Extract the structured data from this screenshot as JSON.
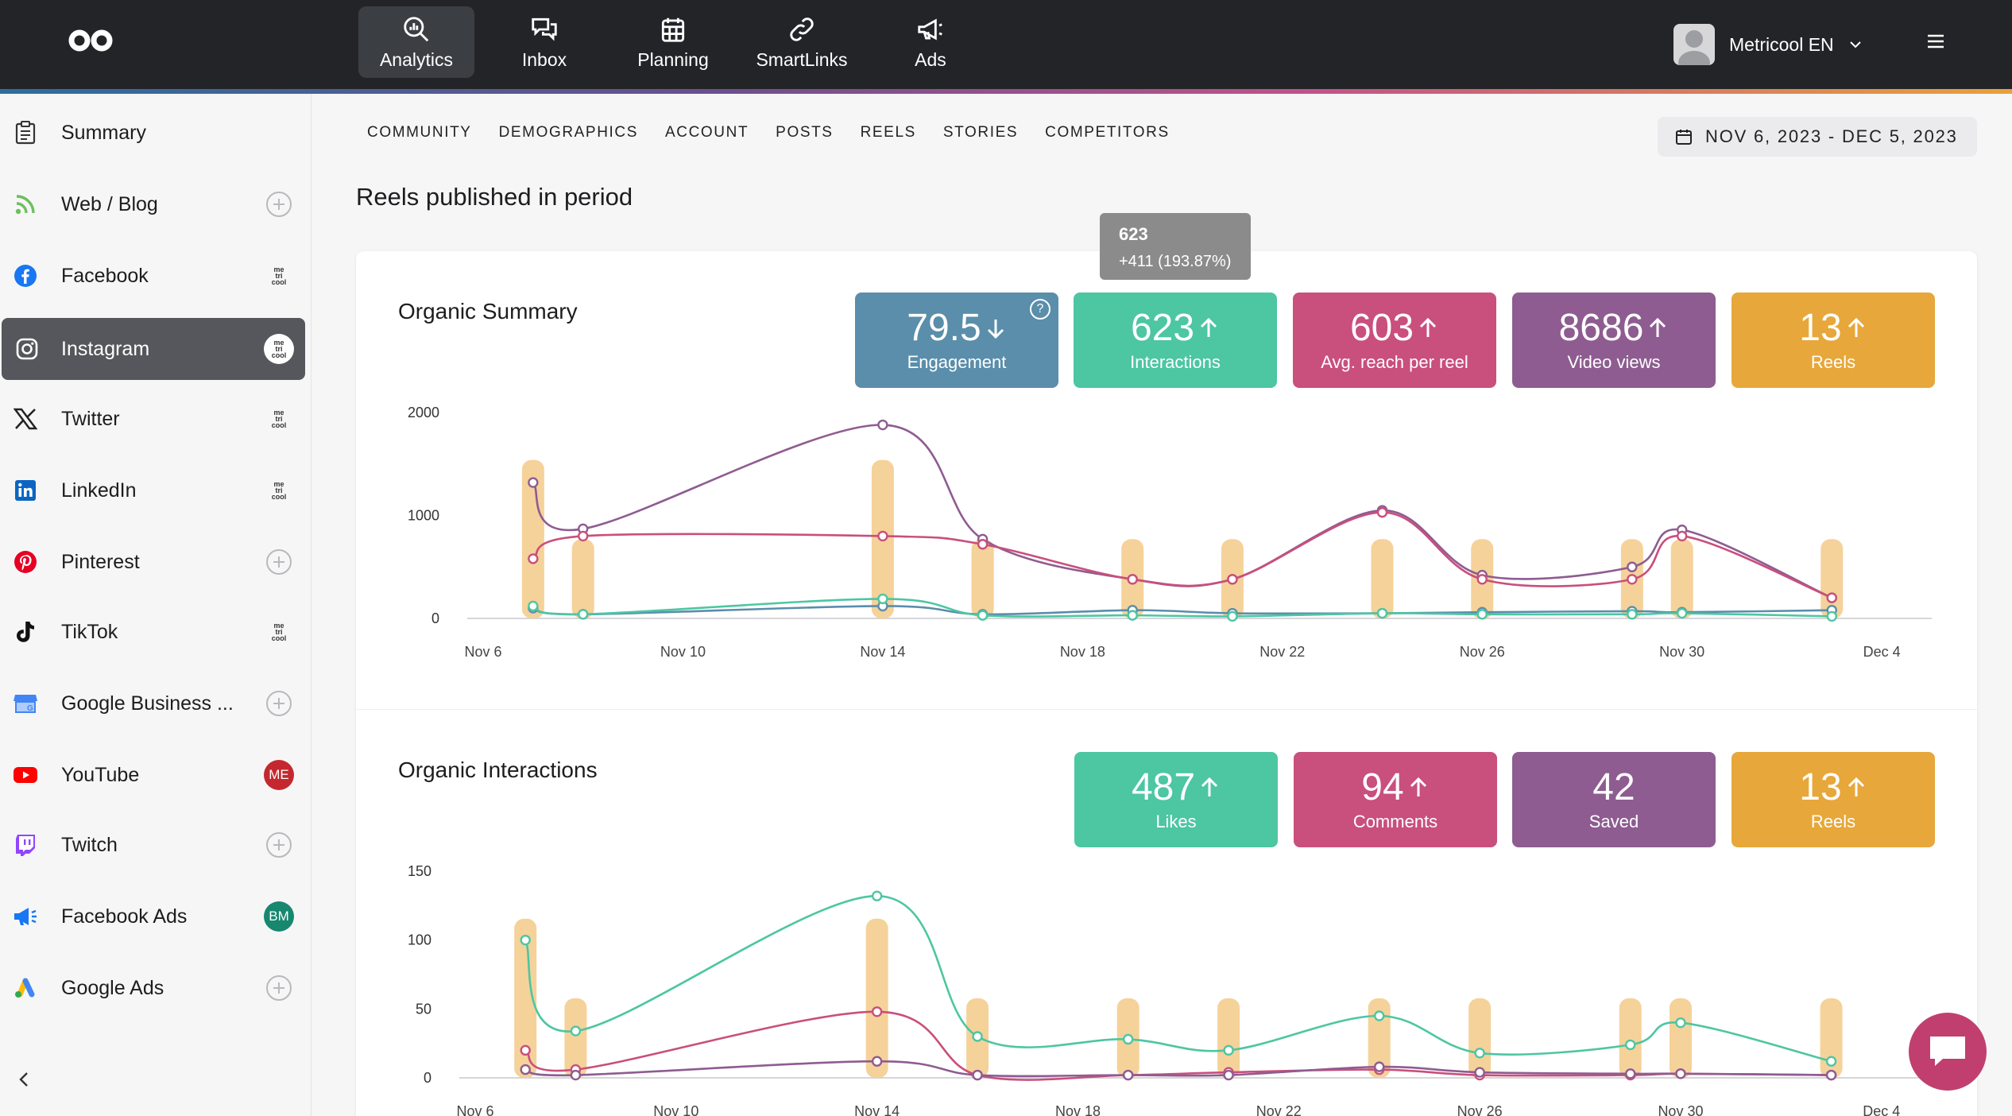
{
  "topnav": {
    "items": [
      {
        "label": "Analytics",
        "icon": "analytics-icon",
        "active": true
      },
      {
        "label": "Inbox",
        "icon": "inbox-icon"
      },
      {
        "label": "Planning",
        "icon": "calendar-icon"
      },
      {
        "label": "SmartLinks",
        "icon": "link-icon"
      },
      {
        "label": "Ads",
        "icon": "megaphone-icon"
      }
    ],
    "profile_name": "Metricool EN"
  },
  "sidebar": {
    "items": [
      {
        "label": "Summary",
        "icon": "clipboard-icon",
        "action": "none"
      },
      {
        "label": "Web / Blog",
        "icon": "rss-icon",
        "action": "add"
      },
      {
        "label": "Facebook",
        "icon": "facebook-icon",
        "action": "logo"
      },
      {
        "label": "Instagram",
        "icon": "instagram-icon",
        "action": "logo",
        "active": true
      },
      {
        "label": "Twitter",
        "icon": "x-icon",
        "action": "logo"
      },
      {
        "label": "LinkedIn",
        "icon": "linkedin-icon",
        "action": "logo"
      },
      {
        "label": "Pinterest",
        "icon": "pinterest-icon",
        "action": "add"
      },
      {
        "label": "TikTok",
        "icon": "tiktok-icon",
        "action": "logo"
      },
      {
        "label": "Google Business ...",
        "icon": "google-business-icon",
        "action": "add"
      },
      {
        "label": "YouTube",
        "icon": "youtube-icon",
        "action": "badge",
        "badge": "ME",
        "badge_color": "#c4282e"
      },
      {
        "label": "Twitch",
        "icon": "twitch-icon",
        "action": "add"
      },
      {
        "label": "Facebook Ads",
        "icon": "facebook-ads-icon",
        "action": "badge",
        "badge": "BM",
        "badge_color": "#17876f"
      },
      {
        "label": "Google Ads",
        "icon": "google-ads-icon",
        "action": "add"
      }
    ],
    "mini_logo": [
      "me",
      "tri",
      "cool"
    ]
  },
  "tabs": [
    "COMMUNITY",
    "DEMOGRAPHICS",
    "ACCOUNT",
    "POSTS",
    "REELS",
    "STORIES",
    "COMPETITORS"
  ],
  "date_range": "NOV 6, 2023 - DEC 5, 2023",
  "page_title": "Reels published in period",
  "tooltip": {
    "value": "623",
    "change": "+411 (193.87%)"
  },
  "organic_summary": {
    "title": "Organic Summary",
    "kpis": [
      {
        "value": "79.5",
        "label": "Engagement",
        "trend": "down",
        "color": "#5a8eab",
        "help": "?"
      },
      {
        "value": "623",
        "label": "Interactions",
        "trend": "up",
        "color": "#4dc6a2"
      },
      {
        "value": "603",
        "label": "Avg. reach per reel",
        "trend": "up",
        "color": "#c94f7c"
      },
      {
        "value": "8686",
        "label": "Video views",
        "trend": "up",
        "color": "#8e5c91"
      },
      {
        "value": "13",
        "label": "Reels",
        "trend": "up",
        "color": "#e7a73a"
      }
    ]
  },
  "organic_interactions": {
    "title": "Organic Interactions",
    "kpis": [
      {
        "value": "487",
        "label": "Likes",
        "trend": "up",
        "color": "#4dc6a2"
      },
      {
        "value": "94",
        "label": "Comments",
        "trend": "up",
        "color": "#c94f7c"
      },
      {
        "value": "42",
        "label": "Saved",
        "trend": "none",
        "color": "#8e5c91"
      },
      {
        "value": "13",
        "label": "Reels",
        "trend": "up",
        "color": "#e7a73a"
      }
    ]
  },
  "chart_data": [
    {
      "type": "line",
      "x_ticks": [
        "Nov 6",
        "Nov 10",
        "Nov 14",
        "Nov 18",
        "Nov 22",
        "Nov 26",
        "Nov 30",
        "Dec 4"
      ],
      "ylim": [
        0,
        2000
      ],
      "y_ticks": [
        0,
        1000,
        2000
      ],
      "grid": false,
      "bars": {
        "name": "Reels",
        "color": "#f5d29a",
        "points": [
          [
            7,
            1
          ],
          [
            8,
            0.5
          ],
          [
            14,
            1
          ],
          [
            16,
            0.5
          ],
          [
            19,
            0.5
          ],
          [
            21,
            0.5
          ],
          [
            24,
            0.5
          ],
          [
            26,
            0.5
          ],
          [
            29,
            0.5
          ],
          [
            30,
            0.5
          ],
          [
            33,
            0.5
          ]
        ]
      },
      "series": [
        {
          "color": "#8e5c91",
          "points": [
            [
              7,
              1320
            ],
            [
              8,
              870
            ],
            [
              14,
              1880
            ],
            [
              16,
              770
            ],
            [
              19,
              380
            ],
            [
              21,
              380
            ],
            [
              24,
              1050
            ],
            [
              26,
              420
            ],
            [
              29,
              500
            ],
            [
              30,
              860
            ],
            [
              33,
              200
            ]
          ]
        },
        {
          "color": "#c94f7c",
          "points": [
            [
              7,
              580
            ],
            [
              8,
              800
            ],
            [
              14,
              800
            ],
            [
              16,
              720
            ],
            [
              19,
              380
            ],
            [
              21,
              380
            ],
            [
              24,
              1030
            ],
            [
              26,
              380
            ],
            [
              29,
              380
            ],
            [
              30,
              800
            ],
            [
              33,
              200
            ]
          ]
        },
        {
          "color": "#5a8eab",
          "points": [
            [
              7,
              100
            ],
            [
              8,
              40
            ],
            [
              14,
              120
            ],
            [
              16,
              40
            ],
            [
              19,
              80
            ],
            [
              21,
              50
            ],
            [
              24,
              50
            ],
            [
              26,
              60
            ],
            [
              29,
              70
            ],
            [
              30,
              60
            ],
            [
              33,
              80
            ]
          ]
        },
        {
          "color": "#4dc6a2",
          "points": [
            [
              7,
              120
            ],
            [
              8,
              40
            ],
            [
              14,
              190
            ],
            [
              16,
              30
            ],
            [
              19,
              30
            ],
            [
              21,
              20
            ],
            [
              24,
              50
            ],
            [
              26,
              40
            ],
            [
              29,
              40
            ],
            [
              30,
              50
            ],
            [
              33,
              20
            ]
          ]
        }
      ]
    },
    {
      "type": "line",
      "x_ticks": [
        "Nov 6",
        "Nov 10",
        "Nov 14",
        "Nov 18",
        "Nov 22",
        "Nov 26",
        "Nov 30",
        "Dec 4"
      ],
      "ylim": [
        0,
        150
      ],
      "y_ticks": [
        0,
        50,
        100,
        150
      ],
      "grid": false,
      "bars": {
        "name": "Reels",
        "color": "#f5d29a",
        "points": [
          [
            7,
            1
          ],
          [
            8,
            0.5
          ],
          [
            14,
            1
          ],
          [
            16,
            0.5
          ],
          [
            19,
            0.5
          ],
          [
            21,
            0.5
          ],
          [
            24,
            0.5
          ],
          [
            26,
            0.5
          ],
          [
            29,
            0.5
          ],
          [
            30,
            0.5
          ],
          [
            33,
            0.5
          ]
        ]
      },
      "series": [
        {
          "color": "#4dc6a2",
          "points": [
            [
              7,
              100
            ],
            [
              8,
              34
            ],
            [
              14,
              132
            ],
            [
              16,
              30
            ],
            [
              19,
              28
            ],
            [
              21,
              20
            ],
            [
              24,
              45
            ],
            [
              26,
              18
            ],
            [
              29,
              24
            ],
            [
              30,
              40
            ],
            [
              33,
              12
            ]
          ]
        },
        {
          "color": "#c94f7c",
          "points": [
            [
              7,
              20
            ],
            [
              8,
              6
            ],
            [
              14,
              48
            ],
            [
              16,
              2
            ],
            [
              19,
              2
            ],
            [
              21,
              4
            ],
            [
              24,
              6
            ],
            [
              26,
              2
            ],
            [
              29,
              2
            ],
            [
              30,
              3
            ],
            [
              33,
              2
            ]
          ]
        },
        {
          "color": "#8e5c91",
          "points": [
            [
              7,
              6
            ],
            [
              8,
              2
            ],
            [
              14,
              12
            ],
            [
              16,
              2
            ],
            [
              19,
              2
            ],
            [
              21,
              2
            ],
            [
              24,
              8
            ],
            [
              26,
              4
            ],
            [
              29,
              3
            ],
            [
              30,
              3
            ],
            [
              33,
              2
            ]
          ]
        }
      ]
    }
  ]
}
